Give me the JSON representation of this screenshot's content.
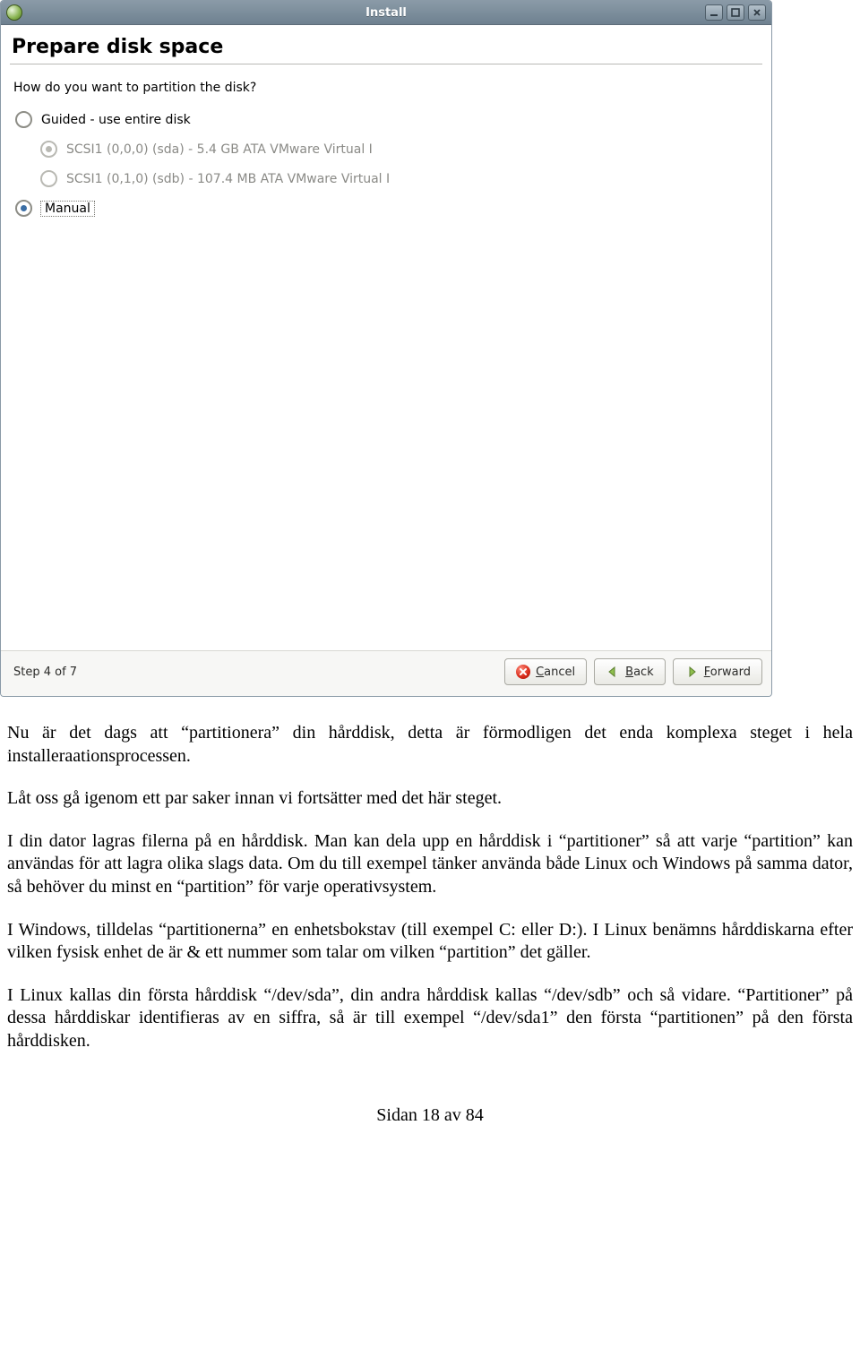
{
  "window": {
    "title": "Install",
    "heading": "Prepare disk space",
    "question": "How do you want to partition the disk?",
    "options": {
      "guided_label": "Guided - use entire disk",
      "disk_a": "SCSI1 (0,0,0) (sda) - 5.4 GB ATA VMware Virtual I",
      "disk_b": "SCSI1 (0,1,0) (sdb) - 107.4 MB ATA VMware Virtual I",
      "manual_label": "Manual"
    },
    "step": "Step 4 of 7",
    "buttons": {
      "cancel_u": "C",
      "cancel_rest": "ancel",
      "back_u": "B",
      "back_rest": "ack",
      "forward_u": "F",
      "forward_rest": "orward"
    }
  },
  "doc": {
    "p1": "Nu är det dags att “partitionera” din hårddisk, detta är förmodligen det enda komplexa steget i hela installeraationsprocessen.",
    "p2": "Låt oss gå igenom ett par saker innan vi fortsätter med det här steget.",
    "p3": "I din dator lagras filerna på en hårddisk. Man kan dela upp en hårddisk i “partitioner” så att varje “partition” kan användas för att lagra olika slags data. Om du till exempel tänker använda både Linux och Windows på samma dator, så behöver du minst en “partition” för varje operativsystem.",
    "p4": "I Windows, tilldelas “partitionerna” en enhetsbokstav (till exempel C: eller D:). I Linux benämns hårddiskarna efter vilken fysisk enhet de är & ett nummer som talar om vilken “partition” det gäller.",
    "p5": "I Linux kallas din första hårddisk “/dev/sda”, din andra hårddisk kallas “/dev/sdb” och så vidare. “Partitioner” på dessa hårddiskar identifieras av en siffra, så är till exempel “/dev/sda1” den första “partitionen” på den första hårddisken.",
    "pager": "Sidan 18 av 84"
  }
}
